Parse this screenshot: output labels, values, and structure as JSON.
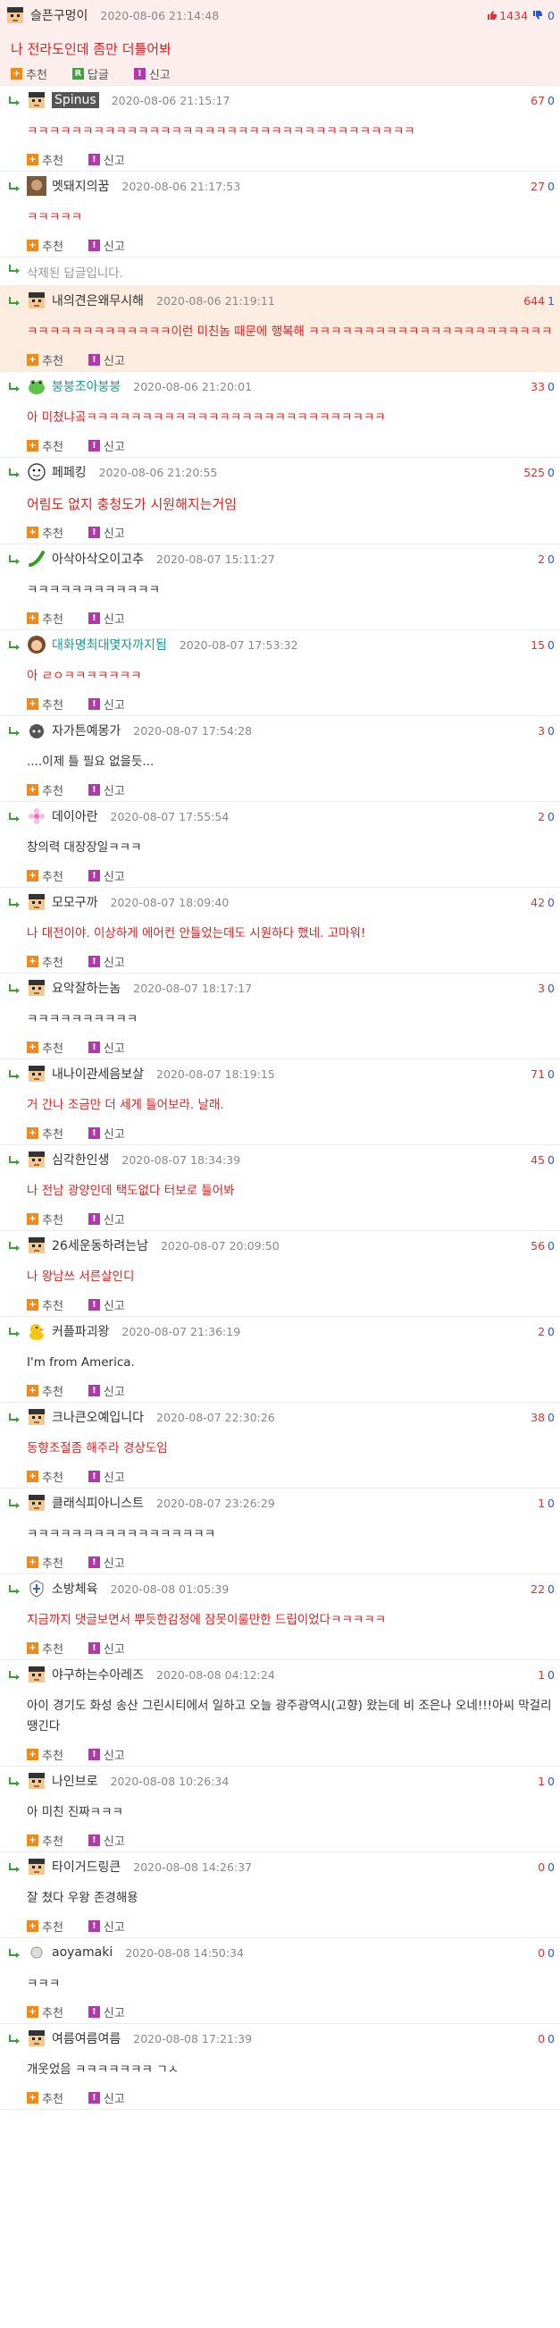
{
  "top_comment": {
    "nickname": "슬픈구멍이",
    "time": "2020-08-06 21:14:48",
    "upvotes": "1434",
    "downvotes": "0",
    "text": "나 전라도인데 좀만 더틀어봐",
    "actions": {
      "recommend": "추천",
      "reply": "답글",
      "report": "신고"
    }
  },
  "labels": {
    "recommend": "추천",
    "report": "신고"
  },
  "deleted_text": "삭제된 답글입니다.",
  "replies": [
    {
      "nickname": "Spinus",
      "time": "2020-08-06 21:15:17",
      "up": "67",
      "down": "0",
      "text": "ㅋㅋㅋㅋㅋㅋㅋㅋㅋㅋㅋㅋㅋㅋㅋㅋㅋㅋㅋㅋㅋㅋㅋㅋㅋㅋㅋㅋㅋㅋㅋㅋㅋㅋㅋ",
      "red": true,
      "big": false,
      "hl": false,
      "avatar": "pixel-avatar",
      "nickbox": true
    },
    {
      "nickname": "멧돼지의꿈",
      "time": "2020-08-06 21:17:53",
      "up": "27",
      "down": "0",
      "text": "ㅋㅋㅋㅋㅋ",
      "red": true,
      "big": false,
      "hl": false,
      "avatar": "photo-avatar"
    },
    {
      "deleted": true
    },
    {
      "nickname": "내의견은왜무시해",
      "time": "2020-08-06 21:19:11",
      "up": "644",
      "down": "1",
      "text": "ㅋㅋㅋㅋㅋㅋㅋㅋㅋㅋㅋㅋㅋ이런 미친놈 때문에 행복해 ㅋㅋㅋㅋㅋㅋㅋㅋㅋㅋㅋㅋㅋㅋㅋㅋㅋㅋㅋㅋㅋㅋ",
      "red": true,
      "big": false,
      "hl": true,
      "avatar": "pixel-avatar"
    },
    {
      "nickname": "붕붕조아붕붕",
      "time": "2020-08-06 21:20:01",
      "up": "33",
      "down": "0",
      "text": "아 미쳤냐곸ㅋㅋㅋㅋㅋㅋㅋㅋㅋㅋㅋㅋㅋㅋㅋㅋㅋㅋㅋㅋㅋㅋㅋㅋㅋㅋㅋ",
      "red": true,
      "big": false,
      "hl": false,
      "avatar": "frog-avatar",
      "teal": true
    },
    {
      "nickname": "페페킹",
      "time": "2020-08-06 21:20:55",
      "up": "525",
      "down": "0",
      "text": "어림도 없지 충청도가 시원해지는거임",
      "red": true,
      "big": true,
      "hl": false,
      "avatar": "face-avatar"
    },
    {
      "nickname": "아삭아삭오이고추",
      "time": "2020-08-07 15:11:27",
      "up": "2",
      "down": "0",
      "text": "ㅋㅋㅋㅋㅋㅋㅋㅋㅋㅋㅋㅋ",
      "red": false,
      "big": false,
      "hl": false,
      "avatar": "pepper-avatar"
    },
    {
      "nickname": "대화명최대몇자까지됨",
      "time": "2020-08-07 17:53:32",
      "up": "15",
      "down": "0",
      "text": "아 ㄹㅇㅋㅋㅋㅋㅋㅋㅋ",
      "red": true,
      "big": false,
      "hl": false,
      "avatar": "girl-avatar",
      "teal": true
    },
    {
      "nickname": "자가튼예몽가",
      "time": "2020-08-07 17:54:28",
      "up": "3",
      "down": "0",
      "text": "....이제 틀 필요 없을듯...",
      "red": false,
      "big": false,
      "hl": false,
      "avatar": "cat-avatar"
    },
    {
      "nickname": "데이아란",
      "time": "2020-08-07 17:55:54",
      "up": "2",
      "down": "0",
      "text": "창의력 대장장일ㅋㅋㅋ",
      "red": false,
      "big": false,
      "hl": false,
      "avatar": "flower-avatar"
    },
    {
      "nickname": "모모구까",
      "time": "2020-08-07 18:09:40",
      "up": "42",
      "down": "0",
      "text": "나 대전이야. 이상하게 에어컨 안틀었는데도 시원하다 했네. 고마워!",
      "red": true,
      "big": false,
      "hl": false,
      "avatar": "pixel-avatar"
    },
    {
      "nickname": "요악잘하는놈",
      "time": "2020-08-07 18:17:17",
      "up": "3",
      "down": "0",
      "text": "ㅋㅋㅋㅋㅋㅋㅋㅋㅋㅋ",
      "red": false,
      "big": false,
      "hl": false,
      "avatar": "pixel-avatar"
    },
    {
      "nickname": "내나이관세음보살",
      "time": "2020-08-07 18:19:15",
      "up": "71",
      "down": "0",
      "text": "거 간나 조금만 더 세게 틀어보라. 날래.",
      "red": true,
      "big": false,
      "hl": false,
      "avatar": "pixel-avatar"
    },
    {
      "nickname": "심각한인생",
      "time": "2020-08-07 18:34:39",
      "up": "45",
      "down": "0",
      "text": "나 전남 광양인데 택도없다 터보로 틀어봐",
      "red": true,
      "big": false,
      "hl": false,
      "avatar": "pixel-avatar"
    },
    {
      "nickname": "26세운동하려는남",
      "time": "2020-08-07 20:09:50",
      "up": "56",
      "down": "0",
      "text": "나 왕남쓰 서른살인디",
      "red": true,
      "big": false,
      "hl": false,
      "avatar": "pixel-avatar"
    },
    {
      "nickname": "커플파괴왕",
      "time": "2020-08-07 21:36:19",
      "up": "2",
      "down": "0",
      "text": "I'm from America.",
      "red": false,
      "big": false,
      "hl": false,
      "avatar": "duck-avatar"
    },
    {
      "nickname": "크나큰오예입니다",
      "time": "2020-08-07 22:30:26",
      "up": "38",
      "down": "0",
      "text": "동향조절좀 해주라 경상도임",
      "red": true,
      "big": false,
      "hl": false,
      "avatar": "pixel-avatar"
    },
    {
      "nickname": "클래식피아니스트",
      "time": "2020-08-07 23:26:29",
      "up": "1",
      "down": "0",
      "text": "ㅋㅋㅋㅋㅋㅋㅋㅋㅋㅋㅋㅋㅋㅋㅋㅋㅋ",
      "red": false,
      "big": false,
      "hl": false,
      "avatar": "pixel-avatar"
    },
    {
      "nickname": "소방체육",
      "time": "2020-08-08 01:05:39",
      "up": "22",
      "down": "0",
      "text": "지금까지 댓글보면서 뿌듯한감정에 잠못이룰만한 드립이었다ㅋㅋㅋㅋㅋ",
      "red": true,
      "big": false,
      "hl": false,
      "avatar": "emblem-avatar"
    },
    {
      "nickname": "야구하는수아레즈",
      "time": "2020-08-08 04:12:24",
      "up": "1",
      "down": "0",
      "text": "아이 경기도 화성 송산 그린시티에서 일하고 오늘 광주광역시(고향) 왔는데 비 조은나 오네!!!아씨 막걸리 땡긴다",
      "red": false,
      "big": false,
      "hl": false,
      "avatar": "pixel-avatar"
    },
    {
      "nickname": "나인브로",
      "time": "2020-08-08 10:26:34",
      "up": "1",
      "down": "0",
      "text": "아 미친 진짜ㅋㅋㅋ",
      "red": false,
      "big": false,
      "hl": false,
      "avatar": "pixel-avatar"
    },
    {
      "nickname": "타이거드링큰",
      "time": "2020-08-08 14:26:37",
      "up": "0",
      "down": "0",
      "text": "잘 쳤다 우왕 존경해용",
      "red": false,
      "big": false,
      "hl": false,
      "avatar": "pixel-avatar"
    },
    {
      "nickname": "aoyamaki",
      "time": "2020-08-08 14:50:34",
      "up": "0",
      "down": "0",
      "text": "ㅋㅋㅋ",
      "red": false,
      "big": false,
      "hl": false,
      "avatar": "small-avatar"
    },
    {
      "nickname": "여름여름여름",
      "time": "2020-08-08 17:21:39",
      "up": "0",
      "down": "0",
      "text": "개웃었음 ㅋㅋㅋㅋㅋㅋㅋ ㄱㅅ",
      "red": false,
      "big": false,
      "hl": false,
      "avatar": "pixel-avatar"
    }
  ]
}
